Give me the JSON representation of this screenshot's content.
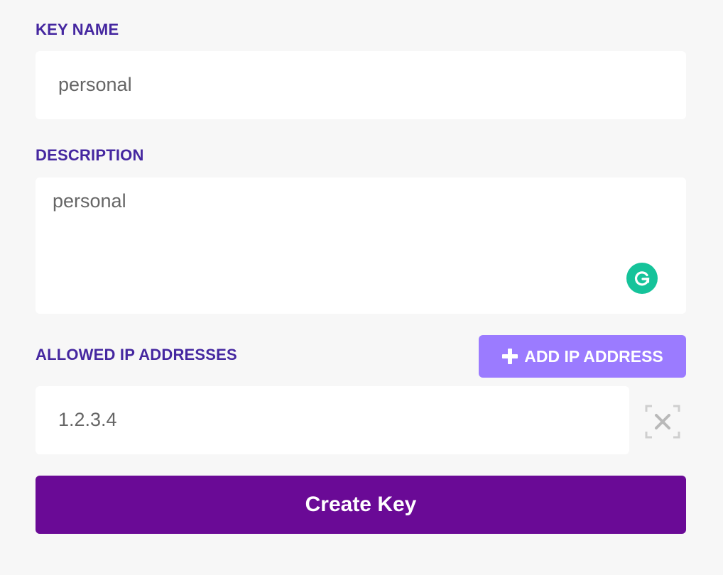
{
  "form": {
    "key_name": {
      "label": "KEY NAME",
      "value": "personal"
    },
    "description": {
      "label": "DESCRIPTION",
      "value": "personal"
    },
    "allowed_ips": {
      "label": "ALLOWED IP ADDRESSES",
      "add_button_label": "ADD IP ADDRESS",
      "add_button_icon": "plus-icon",
      "entries": [
        "1.2.3.4"
      ],
      "remove_icon": "close-icon"
    },
    "submit_label": "Create Key"
  },
  "colors": {
    "label": "#4527a0",
    "add_button": "#9b7bff",
    "submit_button": "#6a0a96",
    "grammarly": "#15c39a",
    "background": "#f7f7f7"
  }
}
